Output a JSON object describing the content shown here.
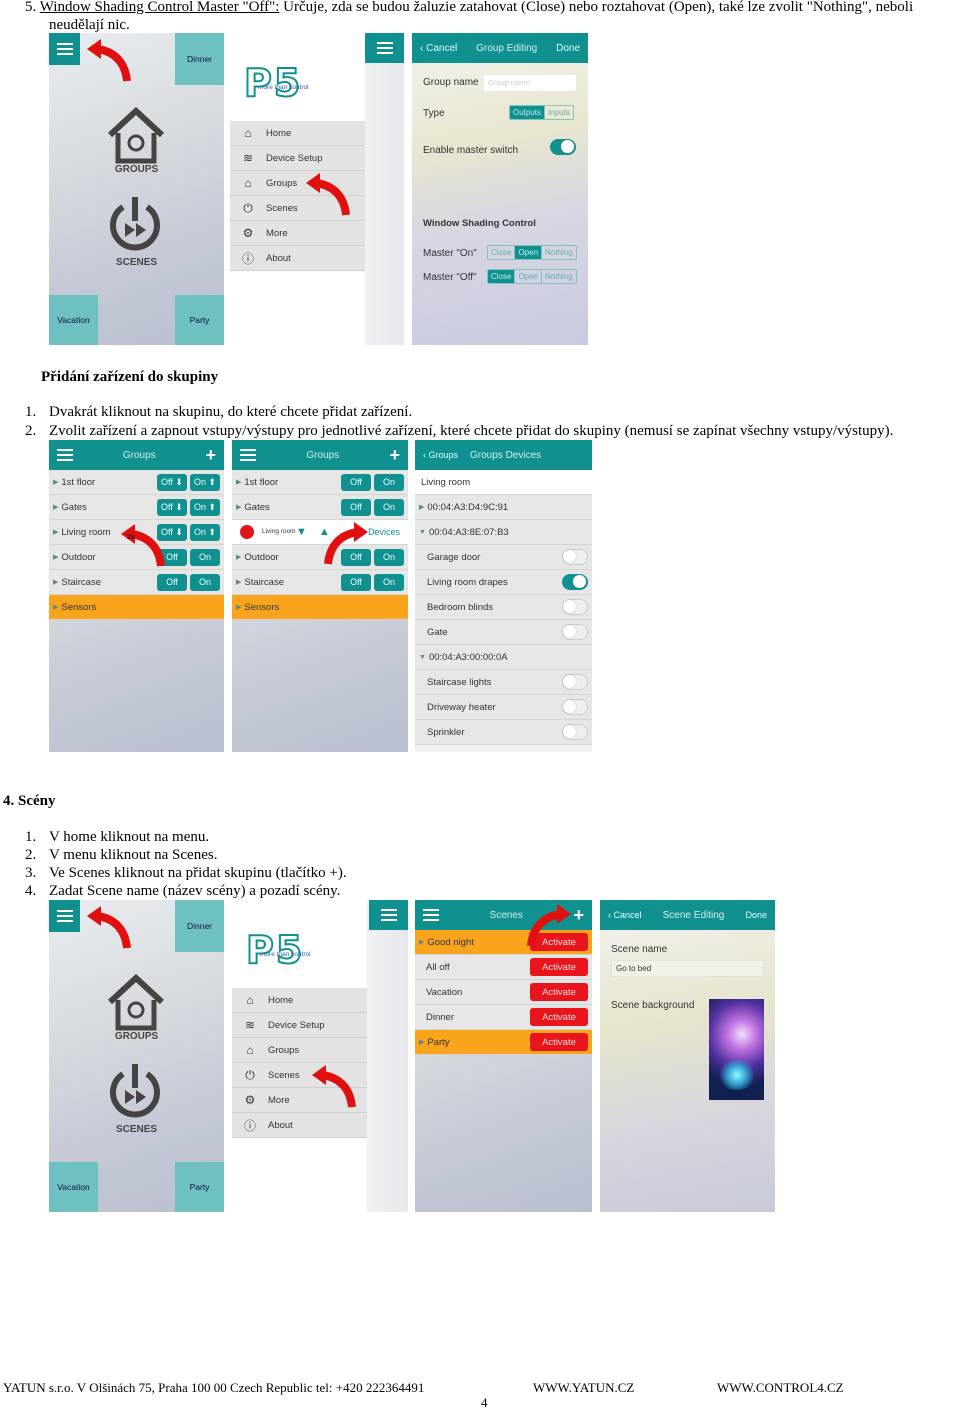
{
  "doc": {
    "item5": {
      "num": "5.",
      "link": "Window Shading Control Master \"Off\":",
      "text": " Určuje, zda se budou žaluzie zatahovat (Close) nebo roztahovat (Open), také lze zvolit \"Nothing\", neboli",
      "text2": "neudělají nic."
    },
    "section_add": {
      "title": "Přidání zařízení do skupiny",
      "items": [
        {
          "num": "1.",
          "text": "Dvakrát kliknout na skupinu, do které chcete přidat zařízení."
        },
        {
          "num": "2.",
          "text": "Zvolit zařízení a zapnout vstupy/výstupy pro jednotlivé zařízení, které chcete přidat do skupiny (nemusí se zapínat všechny vstupy/výstupy)."
        }
      ]
    },
    "section_scenes": {
      "title": "4. Scény",
      "items": [
        {
          "num": "1.",
          "text": "V home kliknout na menu."
        },
        {
          "num": "2.",
          "text": "V menu kliknout na Scenes."
        },
        {
          "num": "3.",
          "text": "Ve Scenes kliknout na přidat skupinu (tlačítko +)."
        },
        {
          "num": "4.",
          "text": "Zadat Scene name (název scény) a pozadí scény."
        }
      ]
    },
    "footer": {
      "address": "YATUN s.r.o. V Olšinách 75,  Praha   100 00  Czech Republic  tel: +420  222364491",
      "web1": "WWW.YATUN.CZ",
      "web2": "WWW.CONTROL4.CZ",
      "page": "4"
    }
  },
  "home": {
    "dinner": "Dinner",
    "vacation": "Vacation",
    "party": "Party",
    "groups": "GROUPS",
    "scenes": "SCENES"
  },
  "menu": {
    "logo": "P5",
    "logo_sub": "more than control",
    "items": [
      "Home",
      "Device Setup",
      "Groups",
      "Scenes",
      "More",
      "About"
    ]
  },
  "group_edit": {
    "cancel": "Cancel",
    "title": "Group Editing",
    "done": "Done",
    "name_label": "Group name",
    "name_placeholder": "Group name",
    "type_label": "Type",
    "outputs": "Outputs",
    "inputs": "Inputs",
    "master_label": "Enable master switch",
    "master_on": true,
    "wsc_title": "Window Shading Control",
    "master_on_label": "Master \"On\"",
    "master_off_label": "Master \"Off\"",
    "close": "Close",
    "open": "Open",
    "nothing": "Nothing",
    "master_on_selected": "Open",
    "master_off_selected": "Close"
  },
  "groups": {
    "title": "Groups",
    "rows": [
      {
        "name": "1st floor",
        "off": "Off ⬇",
        "on": "On ⬆"
      },
      {
        "name": "Gates",
        "off": "Off ⬇",
        "on": "On ⬆"
      },
      {
        "name": "Living room",
        "off": "Off ⬇",
        "on": "On ⬆"
      },
      {
        "name": "Outdoor",
        "off": "Off",
        "on": "On"
      },
      {
        "name": "Staircase",
        "off": "Off",
        "on": "On"
      },
      {
        "name": "Sensors"
      }
    ],
    "hint": "2x"
  },
  "groups2": {
    "title": "Groups",
    "rows": [
      {
        "name": "1st floor",
        "off": "Off",
        "on": "On"
      },
      {
        "name": "Gates",
        "off": "Off",
        "on": "On"
      },
      {
        "name": "Living room",
        "action": "Devices"
      },
      {
        "name": "Outdoor",
        "off": "Off",
        "on": "On"
      },
      {
        "name": "Staircase",
        "off": "Off",
        "on": "On"
      },
      {
        "name": "Sensors"
      }
    ]
  },
  "group_devices": {
    "back": "Groups",
    "title": "Groups Devices",
    "group": "Living room",
    "rows": [
      {
        "name": "00:04:A3:D4:9C:91",
        "type": "mac-collapsed"
      },
      {
        "name": "00:04:A3:8E:07:B3",
        "type": "mac-expanded"
      },
      {
        "name": "Garage door",
        "on": false
      },
      {
        "name": "Living room drapes",
        "on": true
      },
      {
        "name": "Bedroom blinds",
        "on": false
      },
      {
        "name": "Gate",
        "on": false
      },
      {
        "name": "00:04:A3:00:00:0A",
        "type": "mac-expanded"
      },
      {
        "name": "Staircase lights",
        "on": false
      },
      {
        "name": "Driveway heater",
        "on": false
      },
      {
        "name": "Sprinkler",
        "on": false
      }
    ]
  },
  "scenes": {
    "title": "Scenes",
    "activate": "Activate",
    "rows": [
      "Good night",
      "All off",
      "Vacation",
      "Dinner",
      "Party"
    ]
  },
  "scene_edit": {
    "cancel": "Cancel",
    "title": "Scene Editing",
    "done": "Done",
    "name_label": "Scene name",
    "name_value": "Go to bed",
    "bg_label": "Scene background"
  },
  "colors": {
    "teal": "#10918f",
    "orange": "#f9a41c",
    "red": "#e8161c",
    "arrow": "#e01010"
  }
}
